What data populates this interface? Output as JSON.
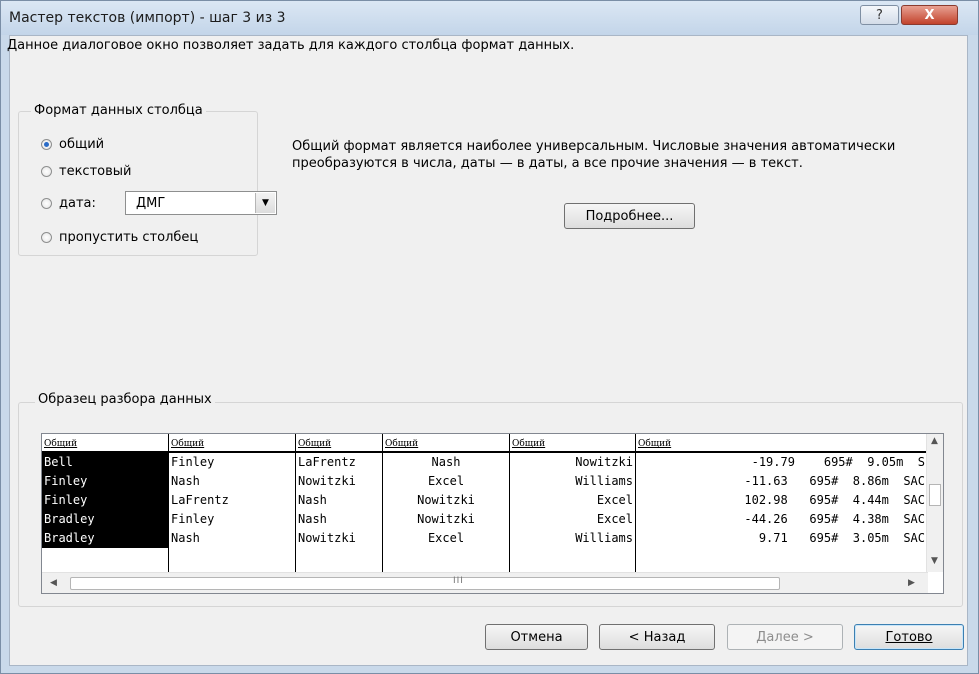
{
  "window": {
    "title": "Мастер текстов (импорт) - шаг 3 из 3",
    "help_label": "?",
    "close_label": "X"
  },
  "intro_text": "Данное диалоговое окно позволяет задать для каждого столбца формат данных.",
  "column_format": {
    "group_title": "Формат данных столбца",
    "options": [
      {
        "label": "общий",
        "checked": true
      },
      {
        "label": "текстовый",
        "checked": false
      },
      {
        "label": "дата:",
        "checked": false
      },
      {
        "label": "пропустить столбец",
        "checked": false
      }
    ],
    "date_format_value": "ДМГ"
  },
  "description": "Общий формат является наиболее универсальным. Числовые значения автоматически преобразуются в числа, даты — в даты, а все прочие значения — в текст.",
  "details_button": "Подробнее...",
  "preview": {
    "group_title": "Образец разбора данных",
    "headers": [
      "Общий",
      "Общий",
      "Общий",
      "Общий",
      "Общий",
      "Общий"
    ],
    "rows": [
      [
        "Bell",
        "Finley",
        "LaFrentz",
        "Nash",
        "Nowitzki",
        "   -19.79    695#  9.05m  S"
      ],
      [
        "Finley",
        "Nash",
        "Nowitzki",
        "Excel",
        "Williams",
        "-11.63   695#  8.86m  SAC"
      ],
      [
        "Finley",
        "LaFrentz",
        "Nash",
        "Nowitzki",
        "Excel",
        "102.98   695#  4.44m  SAC"
      ],
      [
        "Bradley",
        "Finley",
        "Nash",
        "Nowitzki",
        "Excel",
        "-44.26   695#  4.38m  SAC"
      ],
      [
        "Bradley",
        "Nash",
        "Nowitzki",
        "Excel",
        "Williams",
        "  9.71   695#  3.05m  SAC"
      ]
    ],
    "scroll_grip": "III"
  },
  "buttons": {
    "cancel": "Отмена",
    "back": "< Назад",
    "next": "Далее >",
    "finish": "Готово"
  }
}
